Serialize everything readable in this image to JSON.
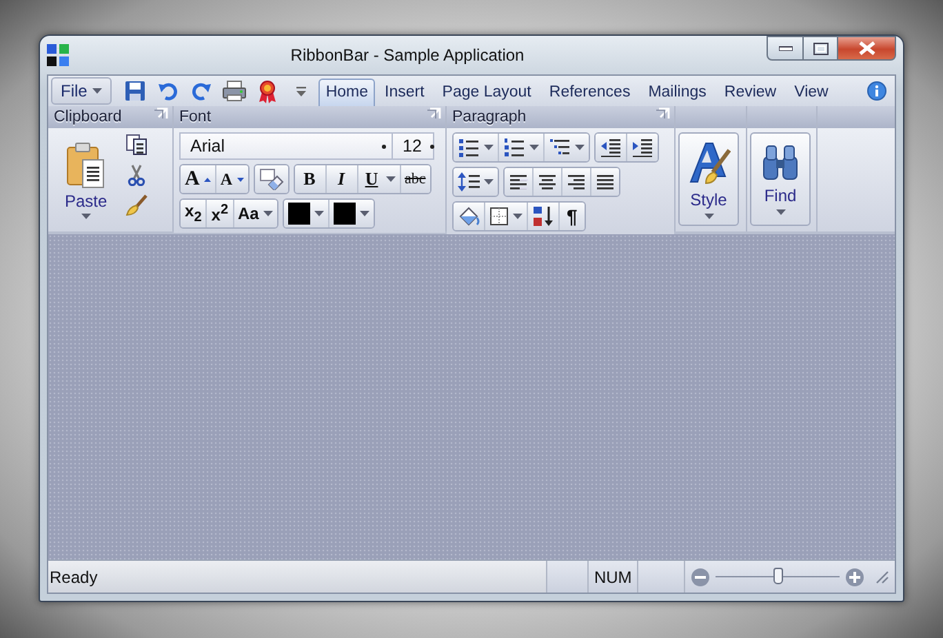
{
  "window": {
    "title": "RibbonBar - Sample Application"
  },
  "file_menu": {
    "label": "File"
  },
  "tabs": [
    {
      "label": "Home",
      "selected": true
    },
    {
      "label": "Insert",
      "selected": false
    },
    {
      "label": "Page Layout",
      "selected": false
    },
    {
      "label": "References",
      "selected": false
    },
    {
      "label": "Mailings",
      "selected": false
    },
    {
      "label": "Review",
      "selected": false
    },
    {
      "label": "View",
      "selected": false
    }
  ],
  "clipboard": {
    "title": "Clipboard",
    "paste_label": "Paste"
  },
  "font": {
    "title": "Font",
    "font_name": "Arial",
    "font_size": "12",
    "grow_label": "A",
    "shrink_label": "A",
    "bold_label": "B",
    "italic_label": "I",
    "underline_label": "U",
    "strike_label": "abc",
    "subscript_label": "x$_{2}$",
    "superscript_label": "x$^{2}$",
    "case_label": "Aa"
  },
  "paragraph": {
    "title": "Paragraph",
    "pilcrow_label": "¶"
  },
  "styles": {
    "label": "Style"
  },
  "editing": {
    "label": "Find"
  },
  "status_bar": {
    "status": "Ready",
    "num_indicator": "NUM",
    "zoom": {
      "level": 0.5
    }
  }
}
